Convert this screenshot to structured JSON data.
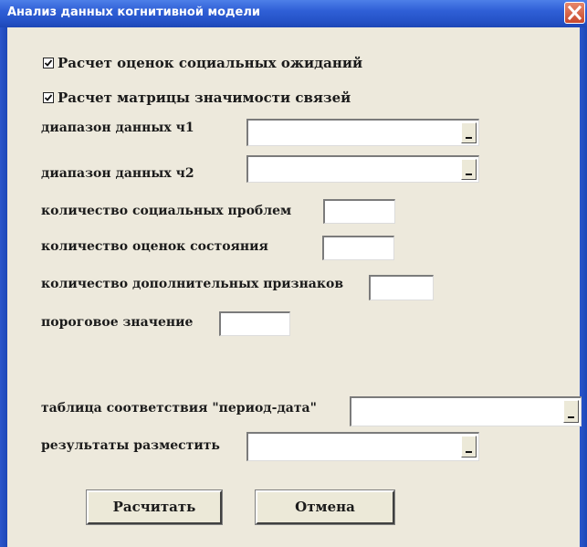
{
  "window": {
    "title": "Анализ данных когнитивной модели"
  },
  "checkboxes": [
    {
      "label": "Расчет оценок социальных  ожиданий",
      "checked": true
    },
    {
      "label": "Расчет матрицы значимости связей",
      "checked": true
    }
  ],
  "fields": {
    "range1": {
      "label": "диапазон данных ч1",
      "value": ""
    },
    "range2": {
      "label": "диапазон данных ч2",
      "value": ""
    },
    "social_problems": {
      "label": "количество социальных проблем",
      "value": ""
    },
    "state_assessments": {
      "label": "количество оценок состояния",
      "value": ""
    },
    "additional_features": {
      "label": "количество дополнительных признаков",
      "value": ""
    },
    "threshold": {
      "label": "пороговое значение",
      "value": ""
    },
    "period_date_table": {
      "label": "таблица соответствия \"период-дата\"",
      "value": ""
    },
    "results_place": {
      "label": "результаты разместить",
      "value": ""
    }
  },
  "buttons": {
    "calculate": "Расчитать",
    "cancel": "Отмена"
  },
  "icons": {
    "close": "close-icon",
    "checkmark": "checkmark-icon",
    "range_select": "range-select-icon"
  },
  "colors": {
    "titlebar": "#2553c8",
    "client": "#ede9dc",
    "close": "#d5573a"
  }
}
